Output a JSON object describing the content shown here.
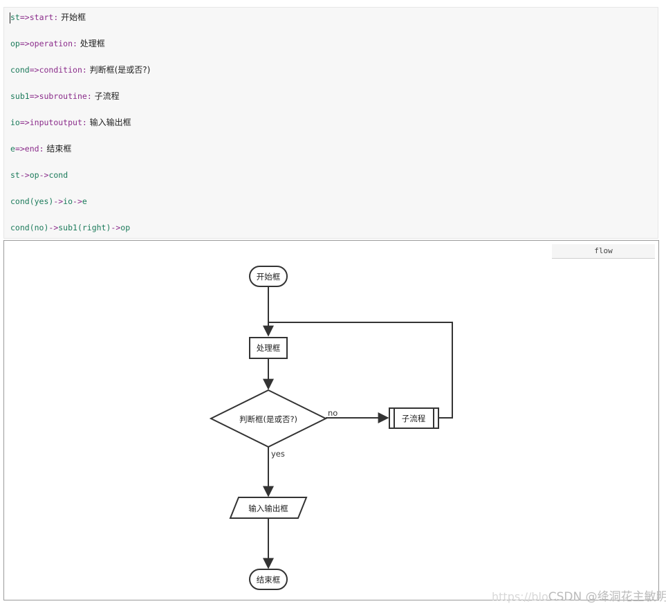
{
  "editor": {
    "lines": [
      {
        "name": "st",
        "op": "=>",
        "type": "start",
        "colon": ":",
        "text": " 开始框"
      },
      {
        "name": "op",
        "op": "=>",
        "type": "operation",
        "colon": ":",
        "text": " 处理框"
      },
      {
        "name": "cond",
        "op": "=>",
        "type": "condition",
        "colon": ":",
        "text": " 判断框(是或否?)"
      },
      {
        "name": "sub1",
        "op": "=>",
        "type": "subroutine",
        "colon": ":",
        "text": " 子流程"
      },
      {
        "name": "io",
        "op": "=>",
        "type": "inputoutput",
        "colon": ":",
        "text": " 输入输出框"
      },
      {
        "name": "e",
        "op": "=>",
        "type": "end",
        "colon": ":",
        "text": " 结束框"
      }
    ],
    "flow_lines": [
      [
        "st",
        "->",
        "op",
        "->",
        "cond"
      ],
      [
        "cond(yes)",
        "->",
        "io",
        "->",
        "e"
      ],
      [
        "cond(no)",
        "->",
        "sub1(right)",
        "->",
        "op"
      ]
    ]
  },
  "preview": {
    "language_tag": "flow",
    "nodes": {
      "start": "开始框",
      "operation": "处理框",
      "condition": "判断框(是或否?)",
      "subroutine": "子流程",
      "inputoutput": "输入输出框",
      "end": "结束框"
    },
    "edge_labels": {
      "no": "no",
      "yes": "yes"
    }
  },
  "watermark": {
    "url": "https://blo",
    "brand": "CSDN @绛洞花主敏明"
  },
  "colors": {
    "identifier": "#1b7a5a",
    "operator": "#8a2b8a",
    "stroke": "#333333"
  }
}
